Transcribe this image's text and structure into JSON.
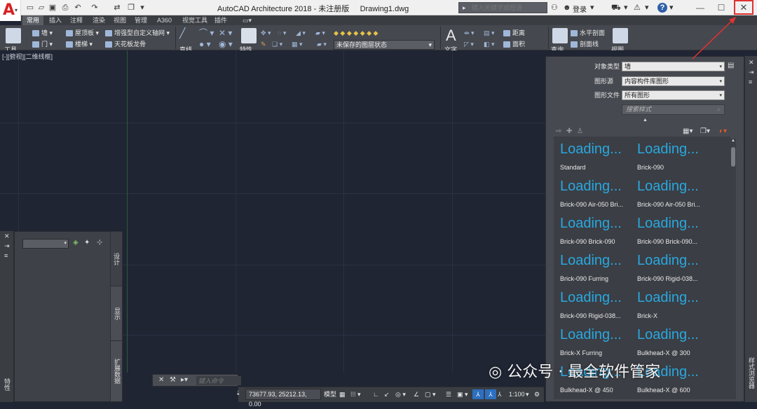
{
  "app": {
    "title": "AutoCAD Architecture 2018 - 未注册版",
    "document": "Drawing1.dwg",
    "logo_letter": "A"
  },
  "titlebar": {
    "search_placeholder": "键入关键字或短语",
    "login_label": "登录",
    "help_label": "?",
    "minimize": "—",
    "maximize": "☐",
    "close": "✕"
  },
  "ribbon": {
    "tabs": [
      "常用",
      "插入",
      "注释",
      "渲染",
      "视图",
      "管理",
      "A360",
      "视觉工具",
      "插件"
    ],
    "active_tab": 0,
    "tools": {
      "wall": "墙",
      "door": "门",
      "roof_slab": "屋顶板",
      "stair": "楼梯",
      "enhanced_grid": "增强型自定义轴网",
      "ceiling_grid": "天花板龙骨",
      "distance": "距离",
      "area": "面积",
      "horizontal_section": "水平剖面",
      "section_line": "剖面线",
      "layer_state": "未保存的图层状态",
      "cut_row_left": "工具",
      "cut_row_2": "直线",
      "cut_row_3": "特性",
      "cut_row_4": "文字",
      "cut_row_5": "查询",
      "cut_row_6": "视图"
    }
  },
  "viewport": {
    "label": "[-][俯视][二维线框]"
  },
  "left_palette": {
    "tabs": [
      "设计",
      "显示",
      "扩展数据"
    ],
    "strip_label": "特性"
  },
  "command_line": {
    "placeholder": "键入命令"
  },
  "status_bar": {
    "coordinates": "73677.93, 25212.13, 0.00",
    "model_label": "模型",
    "scale": "1:100"
  },
  "style_browser": {
    "object_type_label": "对象类型",
    "object_type_value": "墙",
    "drawing_source_label": "图形源",
    "drawing_source_value": "内容构件库图形",
    "drawing_file_label": "图形文件",
    "drawing_file_value": "所有图形",
    "search_placeholder": "搜索样式",
    "side_label": "样式浏览器",
    "loading_text": "Loading...",
    "items": [
      "Standard",
      "Brick-090",
      "Brick-090 Air-050 Bri...",
      "Brick-090 Air-050 Bri...",
      "Brick-090 Brick-090",
      "Brick-090 Brick-090...",
      "Brick-090 Furring",
      "Brick-090 Rigid-038...",
      "Brick-090 Rigid-038...",
      "Brick-X",
      "Brick-X Furring",
      "Bulkhead-X @ 300",
      "Bulkhead-X @ 450",
      "Bulkhead-X @ 600"
    ]
  },
  "watermark": {
    "text": "公众号 · 最全软件管家"
  },
  "colors": {
    "viewport_bg": "#1f2533",
    "accent_blue": "#29a8e0",
    "close_highlight": "#e03232",
    "logo_red": "#d92121"
  }
}
